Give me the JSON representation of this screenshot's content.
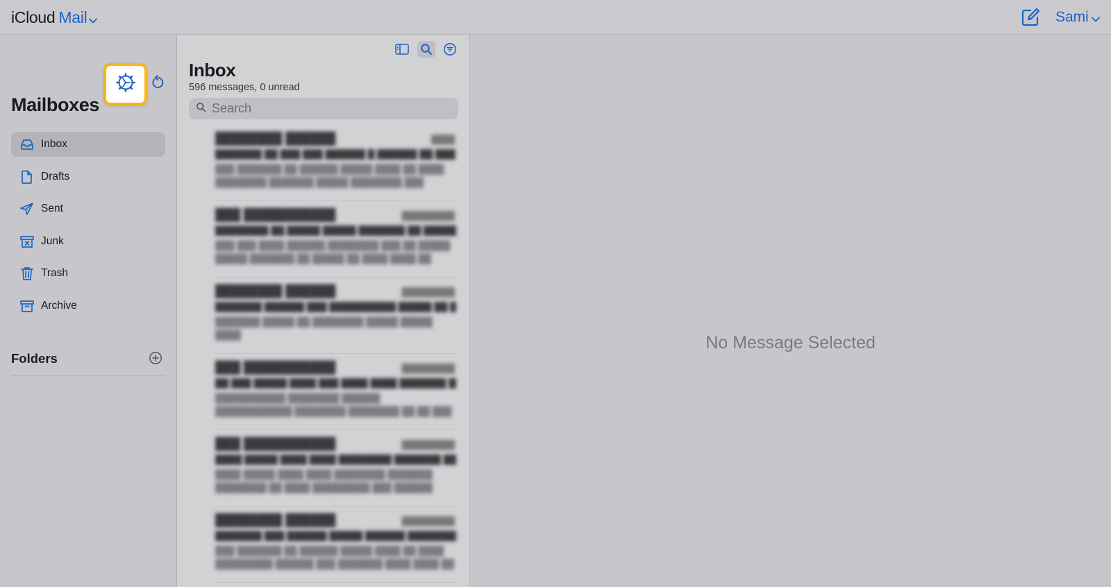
{
  "header": {
    "brand_icloud": "iCloud",
    "brand_mail": "Mail",
    "user_name": "Sami",
    "accent_color": "#1e63c4"
  },
  "sidebar": {
    "title": "Mailboxes",
    "items": [
      {
        "label": "Inbox",
        "icon": "inbox-icon",
        "active": true
      },
      {
        "label": "Drafts",
        "icon": "document-icon"
      },
      {
        "label": "Sent",
        "icon": "paper-plane-icon"
      },
      {
        "label": "Junk",
        "icon": "junk-box-icon"
      },
      {
        "label": "Trash",
        "icon": "trash-icon"
      },
      {
        "label": "Archive",
        "icon": "archive-box-icon"
      }
    ],
    "folders_label": "Folders",
    "highlight_color": "#f7b61d"
  },
  "list": {
    "title": "Inbox",
    "count": "596 messages, 0 unread",
    "search_placeholder": "Search"
  },
  "reader": {
    "empty_text": "No Message Selected"
  }
}
